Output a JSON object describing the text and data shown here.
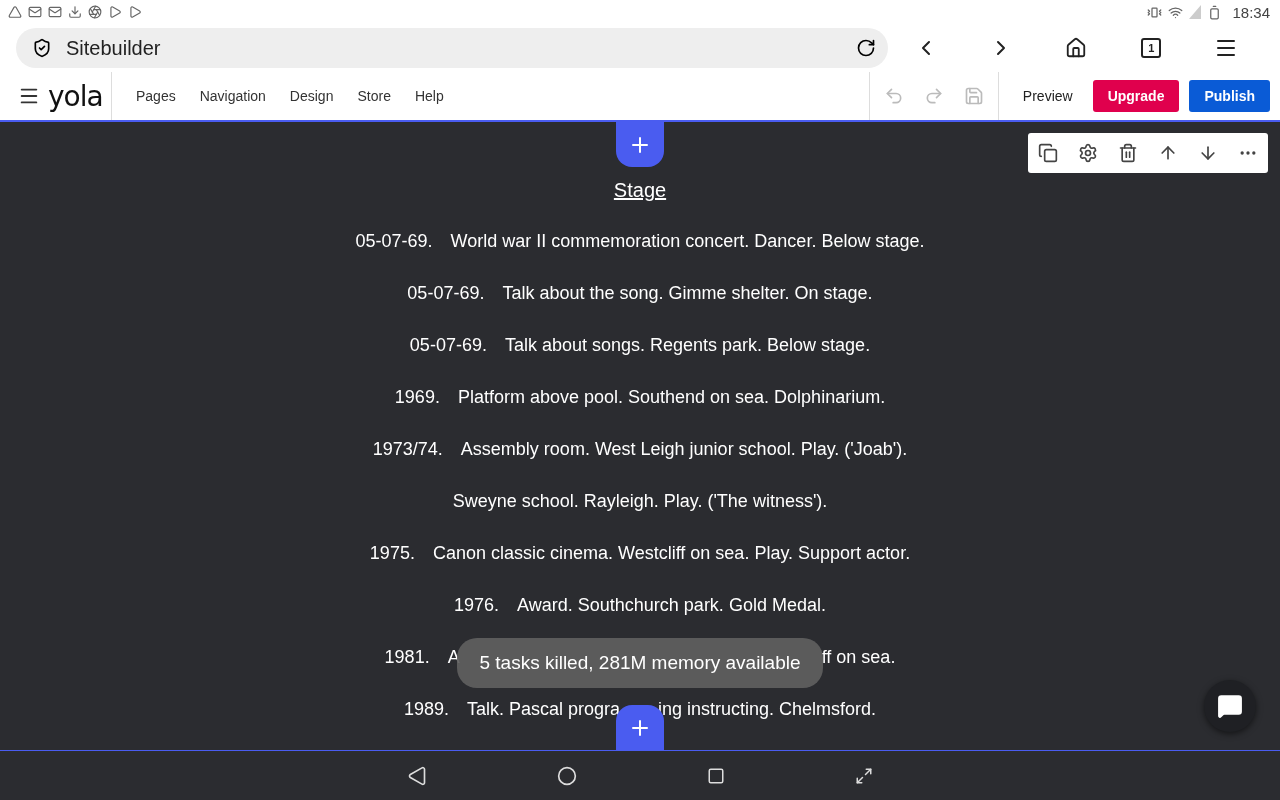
{
  "status_bar": {
    "time": "18:34"
  },
  "browser": {
    "address": "Sitebuilder",
    "tab_count": "1"
  },
  "editor_toolbar": {
    "logo": "yola",
    "menu": [
      "Pages",
      "Navigation",
      "Design",
      "Store",
      "Help"
    ],
    "preview": "Preview",
    "upgrade": "Upgrade",
    "publish": "Publish"
  },
  "content": {
    "title": "Stage",
    "rows": [
      {
        "date": "05-07-69.",
        "text": "World war II commemoration concert. Dancer. Below stage."
      },
      {
        "date": "05-07-69.",
        "text": "Talk about the song. Gimme shelter. On stage."
      },
      {
        "date": "05-07-69.",
        "text": "Talk about songs. Regents park. Below stage."
      },
      {
        "date": "1969.",
        "text": "Platform above pool. Southend on sea. Dolphinarium."
      },
      {
        "date": "1973/74.",
        "text": "Assembly room. West Leigh junior school. Play. ('Joab')."
      },
      {
        "text": "Sweyne school. Rayleigh. Play. ('The witness')."
      },
      {
        "date": "1975.",
        "text": "Canon classic cinema. Westcliff on sea. Play. Support actor."
      },
      {
        "date": "1976.",
        "text": "Award. Southchurch park. Gold Medal."
      },
      {
        "date": "1981.",
        "parts": [
          "A",
          "ff  on sea."
        ],
        "kind": "toast"
      },
      {
        "date": "1989.",
        "parts": [
          "Talk. Pascal progra",
          "ing instructing. Chelmsford."
        ],
        "kind": "button"
      }
    ]
  },
  "toast": "5 tasks killed, 281M memory available"
}
